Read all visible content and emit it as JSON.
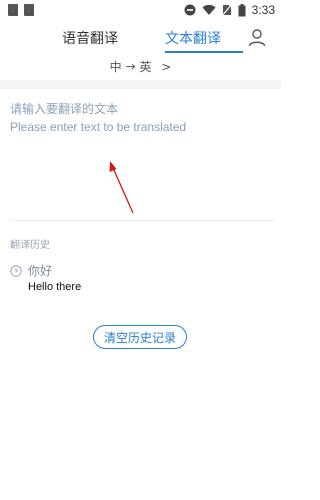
{
  "status_bar": {
    "time": "3:33"
  },
  "tabs": [
    {
      "label": "语音翻译",
      "active": false
    },
    {
      "label": "文本翻译",
      "active": true
    }
  ],
  "language": {
    "source": "中",
    "target": "英",
    "arrow": "→",
    "chevron": ">"
  },
  "input": {
    "placeholder_cn": "请输入要翻译的文本",
    "placeholder_en": "Please enter text to be translated"
  },
  "history": {
    "title": "翻译历史",
    "items": [
      {
        "source": "你好",
        "target": "Hello there"
      }
    ]
  },
  "clear_button": {
    "label": "清空历史记录"
  },
  "colors": {
    "accent": "#2a7fd4",
    "placeholder": "#8ba0b8",
    "annotation_arrow": "#cc1b1b"
  }
}
